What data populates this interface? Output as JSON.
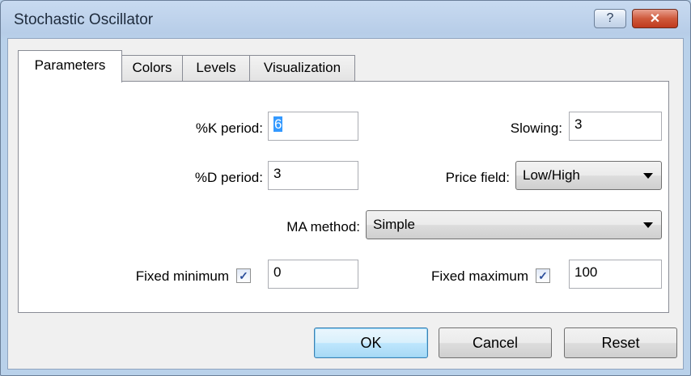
{
  "window": {
    "title": "Stochastic Oscillator",
    "help_glyph": "?",
    "close_glyph": "✕"
  },
  "tabs": [
    {
      "label": "Parameters",
      "active": true
    },
    {
      "label": "Colors",
      "active": false
    },
    {
      "label": "Levels",
      "active": false
    },
    {
      "label": "Visualization",
      "active": false
    }
  ],
  "params": {
    "k_period": {
      "label": "%K period:",
      "value": "6"
    },
    "slowing": {
      "label": "Slowing:",
      "value": "3"
    },
    "d_period": {
      "label": "%D period:",
      "value": "3"
    },
    "price_field": {
      "label": "Price field:",
      "value": "Low/High"
    },
    "ma_method": {
      "label": "MA method:",
      "value": "Simple"
    },
    "fixed_min": {
      "label": "Fixed minimum",
      "checked": true,
      "value": "0"
    },
    "fixed_max": {
      "label": "Fixed maximum",
      "checked": true,
      "value": "100"
    }
  },
  "check_glyph": "✓",
  "buttons": {
    "ok": "OK",
    "cancel": "Cancel",
    "reset": "Reset"
  },
  "colors": {
    "selection": "#3399ff",
    "close_button": "#c03a1e",
    "title_bar": "#b9d1ea"
  }
}
